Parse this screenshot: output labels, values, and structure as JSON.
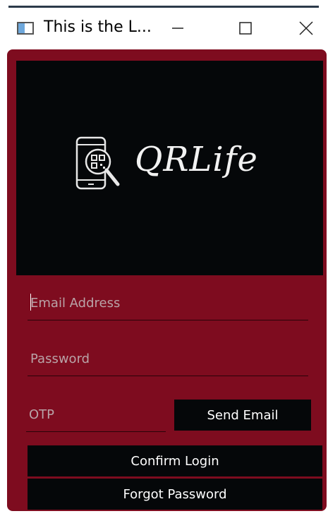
{
  "window": {
    "title": "This is the L...",
    "minimize_glyph": "—",
    "maximize_glyph": "☐",
    "close_glyph": "✕",
    "icon": "app-window-icon"
  },
  "logo": {
    "text": "QRLife",
    "icon": "phone-qr-magnifier-icon"
  },
  "form": {
    "email_placeholder": "Email Address",
    "email_value": "",
    "password_placeholder": "Password",
    "password_value": "",
    "otp_placeholder": "OTP",
    "otp_value": "",
    "send_email_label": "Send Email",
    "confirm_login_label": "Confirm Login",
    "forgot_password_label": "Forgot Password"
  },
  "colors": {
    "window_background": "#7e0c1f",
    "panel_background": "#050709",
    "button_background": "#050709",
    "text_light": "#ffffff"
  }
}
